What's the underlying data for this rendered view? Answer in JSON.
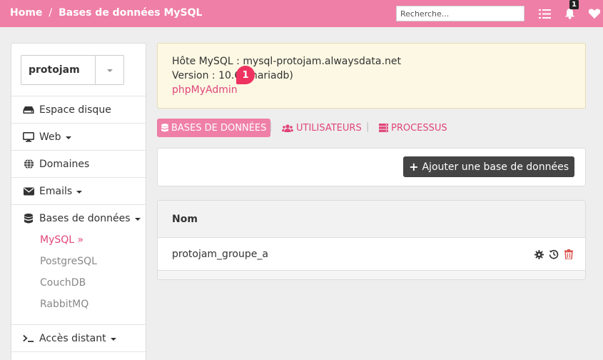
{
  "topbar": {
    "breadcrumb": [
      {
        "label": "Home"
      },
      {
        "label": "Bases de données MySQL"
      }
    ],
    "breadcrumb_separator": "/",
    "search_placeholder": "Recherche...",
    "notification_count": "1",
    "icons": [
      "tasks-icon",
      "bell-icon",
      "heart-icon"
    ]
  },
  "sidebar": {
    "account": "protojam",
    "items": [
      {
        "label": "Espace disque",
        "icon": "hdd-icon",
        "has_caret": false
      },
      {
        "label": "Web",
        "icon": "monitor-icon",
        "has_caret": true
      },
      {
        "label": "Domaines",
        "icon": "globe-icon",
        "has_caret": false
      },
      {
        "label": "Emails",
        "icon": "envelope-icon",
        "has_caret": true
      },
      {
        "label": "Bases de données",
        "icon": "database-icon",
        "has_caret": true
      },
      {
        "label": "Accès distant",
        "icon": "terminal-icon",
        "has_caret": true
      }
    ],
    "db_subitems": [
      {
        "label": "MySQL »",
        "active": true
      },
      {
        "label": "PostgreSQL",
        "active": false
      },
      {
        "label": "CouchDB",
        "active": false
      },
      {
        "label": "RabbitMQ",
        "active": false
      }
    ]
  },
  "info": {
    "host_line": "Hôte MySQL : mysql-protojam.alwaysdata.net",
    "version_line": "Version : 10.6 (mariadb)",
    "phpmyadmin_link": "phpMyAdmin",
    "bubble": "1"
  },
  "tabs": [
    {
      "label": "BASES DE DONNÉES",
      "icon": "database-icon",
      "active": true
    },
    {
      "label": "UTILISATEURS",
      "icon": "users-icon",
      "active": false
    },
    {
      "label": "PROCESSUS",
      "icon": "server-icon",
      "active": false
    }
  ],
  "tab_separator": "|",
  "actions": {
    "add_database": "Ajouter une base de données"
  },
  "table": {
    "header": "Nom",
    "rows": [
      {
        "name": "protojam_groupe_a"
      }
    ]
  },
  "colors": {
    "accent": "#ef7fa6",
    "link": "#e0457b",
    "info_bg": "#fcf8e3",
    "danger": "#d9534f"
  }
}
